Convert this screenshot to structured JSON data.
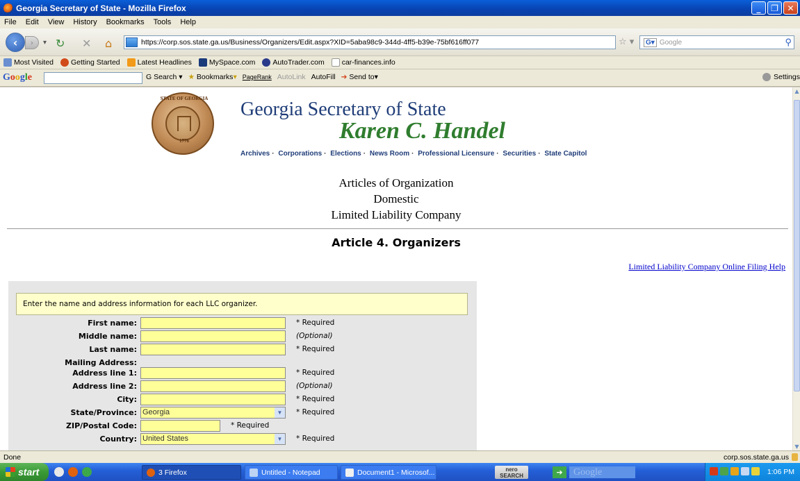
{
  "window": {
    "title": "Georgia Secretary of State - Mozilla Firefox"
  },
  "menu": [
    "File",
    "Edit",
    "View",
    "History",
    "Bookmarks",
    "Tools",
    "Help"
  ],
  "nav": {
    "url": "https://corp.sos.state.ga.us/Business/Organizers/Edit.aspx?XID=5aba98c9-344d-4ff5-b39e-75bf616ff077",
    "search_placeholder": "Google"
  },
  "bookmarks": [
    "Most Visited",
    "Getting Started",
    "Latest Headlines",
    "MySpace.com",
    "AutoTrader.com",
    "car-finances.info"
  ],
  "google_toolbar": {
    "items": [
      "Search",
      "Bookmarks",
      "PageRank",
      "AutoLink",
      "AutoFill",
      "Send to"
    ],
    "settings": "Settings"
  },
  "seal": {
    "top_text": "STATE OF GEORGIA",
    "year": "1776"
  },
  "header": {
    "title": "Georgia Secretary of State",
    "name": "Karen C. Handel"
  },
  "nav_links": [
    "Archives",
    "Corporations",
    "Elections",
    "News Room",
    "Professional Licensure",
    "Securities",
    "State Capitol"
  ],
  "articles": {
    "line1": "Articles of Organization",
    "line2": "Domestic",
    "line3": "Limited Liability Company"
  },
  "section_title": "Article 4. Organizers",
  "help_link": "Limited Liability Company Online Filing Help",
  "form": {
    "instruction": "Enter the name and address information for each LLC organizer.",
    "fields": [
      {
        "label": "First name:",
        "note": "* Required"
      },
      {
        "label": "Middle name:",
        "note": "(Optional)"
      },
      {
        "label": "Last name:",
        "note": "* Required"
      },
      {
        "label": "Mailing Address:"
      },
      {
        "label": "Address line 1:",
        "note": "* Required"
      },
      {
        "label": "Address line 2:",
        "note": "(Optional)"
      },
      {
        "label": "City:",
        "note": "* Required"
      },
      {
        "label": "State/Province:",
        "value": "Georgia",
        "note": "* Required"
      },
      {
        "label": "ZIP/Postal Code:",
        "note": "* Required"
      },
      {
        "label": "Country:",
        "value": "United States",
        "note": "* Required"
      }
    ]
  },
  "status": {
    "left": "Done",
    "right": "corp.sos.state.ga.us"
  },
  "taskbar": {
    "start": "start",
    "tasks": [
      "3 Firefox",
      "Untitled - Notepad",
      "Document1 - Microsof..."
    ],
    "nero": "nero SEARCH",
    "clock": "1:06 PM"
  },
  "colors": {
    "title_blue": "#1f3d78",
    "name_green": "#2f7d2f",
    "field_yellow": "#ffff99",
    "link_blue": "#0000cc"
  }
}
